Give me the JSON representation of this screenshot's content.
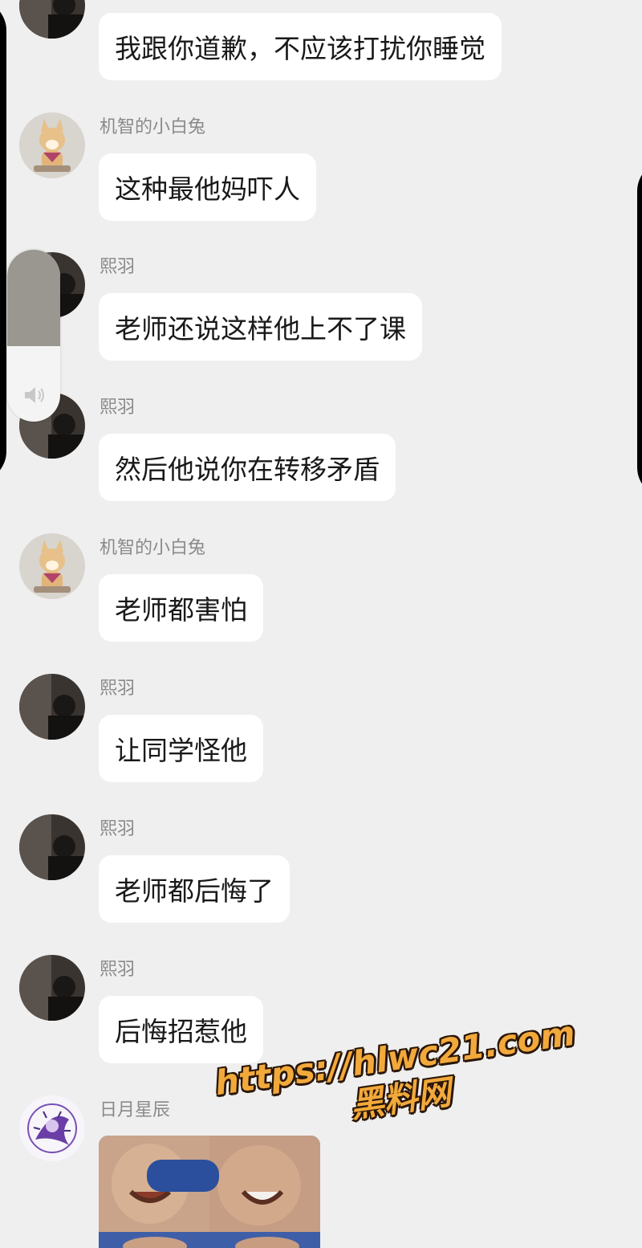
{
  "chat": {
    "messages": [
      {
        "sender": "",
        "text": "我跟你道歉，不应该打扰你睡觉",
        "avatar": "avatar-xiyu"
      },
      {
        "sender": "机智的小白兔",
        "text": "这种最他妈吓人",
        "avatar": "avatar-dog"
      },
      {
        "sender": "熙羽",
        "text": "老师还说这样他上不了课",
        "avatar": "avatar-xiyu"
      },
      {
        "sender": "熙羽",
        "text": "然后他说你在转移矛盾",
        "avatar": "avatar-xiyu"
      },
      {
        "sender": "机智的小白兔",
        "text": "老师都害怕",
        "avatar": "avatar-dog"
      },
      {
        "sender": "熙羽",
        "text": "让同学怪他",
        "avatar": "avatar-xiyu"
      },
      {
        "sender": "熙羽",
        "text": "老师都后悔了",
        "avatar": "avatar-xiyu"
      },
      {
        "sender": "熙羽",
        "text": "后悔招惹他",
        "avatar": "avatar-xiyu"
      },
      {
        "sender": "日月星辰",
        "text": "",
        "avatar": "avatar-anime",
        "image": "meme-sticker"
      }
    ]
  },
  "volume_overlay": {
    "icon": "speaker-icon",
    "level": 0.44
  },
  "watermark": {
    "url": "https://hlwc21.com",
    "name": "黑料网"
  },
  "colors": {
    "background": "#efefef",
    "bubble": "#ffffff",
    "text": "#191919",
    "sender": "#8a8a8a",
    "watermark": "#f2a93b"
  }
}
